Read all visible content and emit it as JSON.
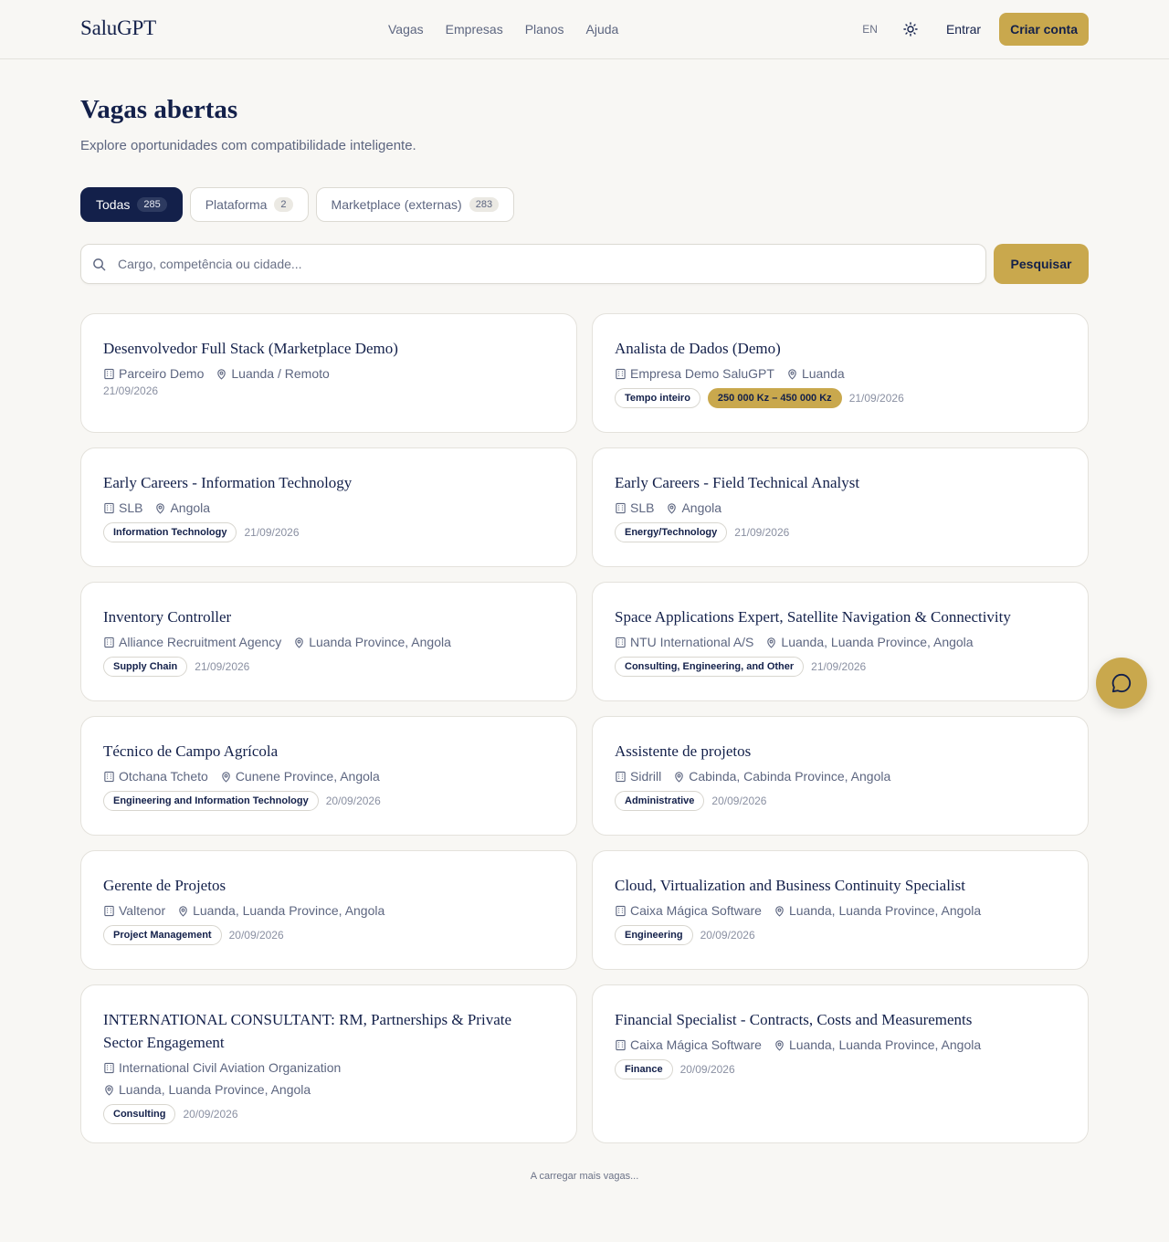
{
  "header": {
    "logo": "SaluGPT",
    "nav": [
      "Vagas",
      "Empresas",
      "Planos",
      "Ajuda"
    ],
    "lang": "EN",
    "login": "Entrar",
    "signup": "Criar conta"
  },
  "page": {
    "title": "Vagas abertas",
    "subtitle": "Explore oportunidades com compatibilidade inteligente."
  },
  "tabs": [
    {
      "label": "Todas",
      "count": "285",
      "active": true
    },
    {
      "label": "Plataforma",
      "count": "2",
      "active": false
    },
    {
      "label": "Marketplace (externas)",
      "count": "283",
      "active": false
    }
  ],
  "search": {
    "placeholder": "Cargo, competência ou cidade...",
    "value": "",
    "button": "Pesquisar"
  },
  "jobs": [
    {
      "title": "Desenvolvedor Full Stack (Marketplace Demo)",
      "company": "Parceiro Demo",
      "location": "Luanda / Remoto",
      "tags": [],
      "salary": "",
      "date": "21/09/2026"
    },
    {
      "title": "Analista de Dados (Demo)",
      "company": "Empresa Demo SaluGPT",
      "location": "Luanda",
      "tags": [
        "Tempo inteiro"
      ],
      "salary": "250 000 Kz – 450 000 Kz",
      "date": "21/09/2026"
    },
    {
      "title": "Early Careers - Information Technology",
      "company": "SLB",
      "location": "Angola",
      "tags": [
        "Information Technology"
      ],
      "salary": "",
      "date": "21/09/2026"
    },
    {
      "title": "Early Careers - Field Technical Analyst",
      "company": "SLB",
      "location": "Angola",
      "tags": [
        "Energy/Technology"
      ],
      "salary": "",
      "date": "21/09/2026"
    },
    {
      "title": "Inventory Controller",
      "company": "Alliance Recruitment Agency",
      "location": "Luanda Province, Angola",
      "tags": [
        "Supply Chain"
      ],
      "salary": "",
      "date": "21/09/2026"
    },
    {
      "title": "Space Applications Expert, Satellite Navigation & Connectivity",
      "company": "NTU International A/S",
      "location": "Luanda, Luanda Province, Angola",
      "tags": [
        "Consulting, Engineering, and Other"
      ],
      "salary": "",
      "date": "21/09/2026"
    },
    {
      "title": "Técnico de Campo Agrícola",
      "company": "Otchana Tcheto",
      "location": "Cunene Province, Angola",
      "tags": [
        "Engineering and Information Technology"
      ],
      "salary": "",
      "date": "20/09/2026"
    },
    {
      "title": "Assistente de projetos",
      "company": "Sidrill",
      "location": "Cabinda, Cabinda Province, Angola",
      "tags": [
        "Administrative"
      ],
      "salary": "",
      "date": "20/09/2026"
    },
    {
      "title": "Gerente de Projetos",
      "company": "Valtenor",
      "location": "Luanda, Luanda Province, Angola",
      "tags": [
        "Project Management"
      ],
      "salary": "",
      "date": "20/09/2026"
    },
    {
      "title": "Cloud, Virtualization and Business Continuity Specialist",
      "company": "Caixa Mágica Software",
      "location": "Luanda, Luanda Province, Angola",
      "tags": [
        "Engineering"
      ],
      "salary": "",
      "date": "20/09/2026"
    },
    {
      "title": "INTERNATIONAL CONSULTANT: RM, Partnerships & Private Sector Engagement",
      "company": "International Civil Aviation Organization",
      "location": "Luanda, Luanda Province, Angola",
      "tags": [
        "Consulting"
      ],
      "salary": "",
      "date": "20/09/2026"
    },
    {
      "title": "Financial Specialist - Contracts, Costs and Measurements",
      "company": "Caixa Mágica Software",
      "location": "Luanda, Luanda Province, Angola",
      "tags": [
        "Finance"
      ],
      "salary": "",
      "date": "20/09/2026"
    }
  ],
  "loading": "A carregar mais vagas...",
  "icons": {
    "theme": "sun-icon",
    "search": "search-icon",
    "company": "building-icon",
    "location": "map-pin-icon",
    "chat": "chat-bubble-icon"
  },
  "colors": {
    "navy": "#13204a",
    "gold": "#c9a84d",
    "background": "#f8f7f4"
  }
}
